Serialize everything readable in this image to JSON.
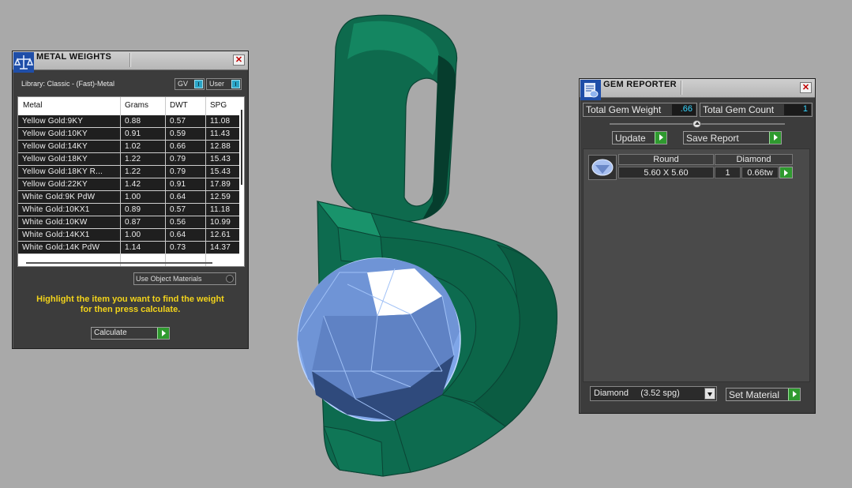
{
  "metal_weights": {
    "title": "METAL WEIGHTS",
    "library": "Library: Classic - (Fast)-Metal",
    "toggle_gv": "GV",
    "toggle_user": "User",
    "columns": [
      "Metal",
      "Grams",
      "DWT",
      "SPG"
    ],
    "rows": [
      {
        "metal": "Yellow Gold:9KY",
        "grams": "0.88",
        "dwt": "0.57",
        "spg": "11.08"
      },
      {
        "metal": "Yellow Gold:10KY",
        "grams": "0.91",
        "dwt": "0.59",
        "spg": "11.43"
      },
      {
        "metal": "Yellow Gold:14KY",
        "grams": "1.02",
        "dwt": "0.66",
        "spg": "12.88"
      },
      {
        "metal": "Yellow Gold:18KY",
        "grams": "1.22",
        "dwt": "0.79",
        "spg": "15.43"
      },
      {
        "metal": "Yellow Gold:18KY R...",
        "grams": "1.22",
        "dwt": "0.79",
        "spg": "15.43"
      },
      {
        "metal": "Yellow Gold:22KY",
        "grams": "1.42",
        "dwt": "0.91",
        "spg": "17.89"
      },
      {
        "metal": "White Gold:9K PdW",
        "grams": "1.00",
        "dwt": "0.64",
        "spg": "12.59"
      },
      {
        "metal": "White Gold:10KX1",
        "grams": "0.89",
        "dwt": "0.57",
        "spg": "11.18"
      },
      {
        "metal": "White Gold:10KW",
        "grams": "0.87",
        "dwt": "0.56",
        "spg": "10.99"
      },
      {
        "metal": "White Gold:14KX1",
        "grams": "1.00",
        "dwt": "0.64",
        "spg": "12.61"
      },
      {
        "metal": "White Gold:14K PdW",
        "grams": "1.14",
        "dwt": "0.73",
        "spg": "14.37"
      }
    ],
    "use_object_materials": "Use Object Materials",
    "hint_line1": "Highlight the item you want to find the weight",
    "hint_line2": "for then press calculate.",
    "calculate_label": "Calculate"
  },
  "gem_reporter": {
    "title": "GEM REPORTER",
    "total_weight_label": "Total Gem Weight",
    "total_weight_value": ".66",
    "total_count_label": "Total Gem Count",
    "total_count_value": "1",
    "update_label": "Update",
    "save_report_label": "Save Report",
    "gem": {
      "shape": "Round",
      "size": "5.60 X 5.60",
      "material": "Diamond",
      "count": "1",
      "weight": "0.66tw"
    },
    "material_select": "Diamond     (3.52 spg)",
    "set_material_label": "Set Material"
  },
  "colors": {
    "metal_green": "#0d6b4f",
    "gem_blue": "#7fa6e8",
    "hint_yellow": "#f2d31b",
    "value_cyan": "#35d6ff",
    "go_green": "#2f9a2f"
  }
}
